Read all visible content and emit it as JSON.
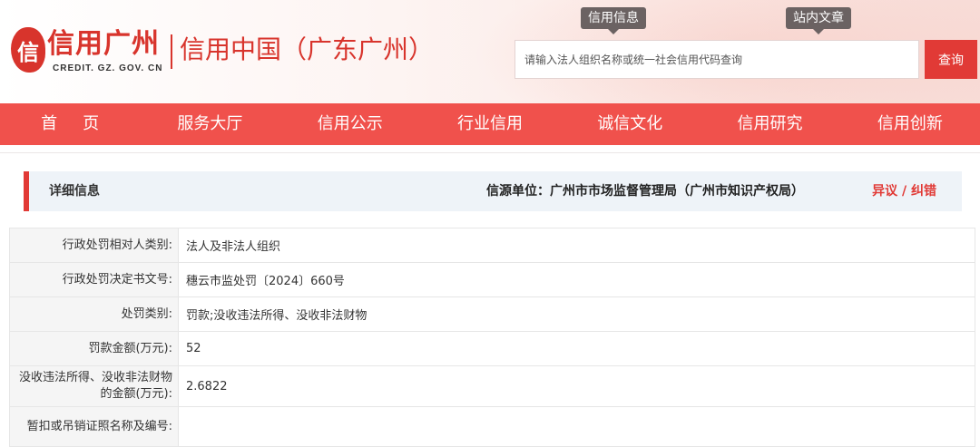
{
  "header": {
    "logo_mark": "信",
    "logo_name": "信用广州",
    "logo_sub": "CREDIT. GZ. GOV. CN",
    "region_title": "信用中国（广东广州）",
    "search_tabs": [
      "信用信息",
      "站内文章"
    ],
    "search_placeholder": "请输入法人组织名称或统一社会信用代码查询",
    "search_button": "查询"
  },
  "nav": {
    "items": [
      "首页",
      "服务大厅",
      "信用公示",
      "行业信用",
      "诚信文化",
      "信用研究",
      "信用创新"
    ]
  },
  "panel": {
    "title": "详细信息",
    "source": "信源单位：广州市市场监督管理局（广州市知识产权局）",
    "objection": "异议 / 纠错"
  },
  "rows": [
    {
      "label": "行政处罚相对人类别:",
      "value": "法人及非法人组织"
    },
    {
      "label": "行政处罚决定书文号:",
      "value": "穗云市监处罚〔2024〕660号"
    },
    {
      "label": "处罚类别:",
      "value": "罚款;没收违法所得、没收非法财物"
    },
    {
      "label": "罚款金额(万元):",
      "value": "52"
    },
    {
      "label": "没收违法所得、没收非法财物的金额(万元):",
      "value": "2.6822"
    },
    {
      "label": "暂扣或吊销证照名称及编号:",
      "value": ""
    }
  ],
  "colors": {
    "brand_red": "#e13a36",
    "nav_red": "#f0514c",
    "label_bg": "#f5f5f5",
    "panel_bg": "#eef3f8"
  }
}
